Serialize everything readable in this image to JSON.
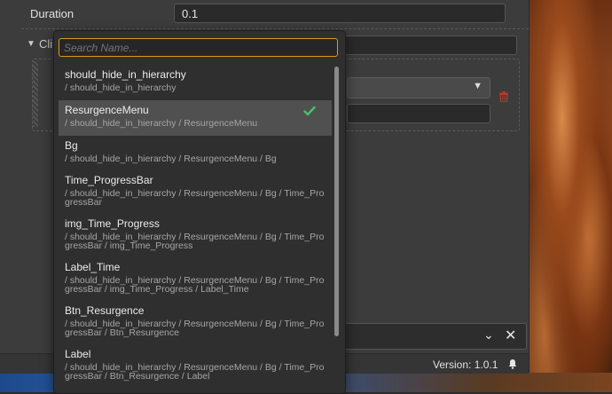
{
  "inspector": {
    "duration_label": "Duration",
    "duration_value": "0.1",
    "clips_label": "Cli",
    "version": "Version: 1.0.1"
  },
  "dropdown": {
    "search_placeholder": "Search Name...",
    "items": [
      {
        "name": "should_hide_in_hierarchy",
        "path": "/ should_hide_in_hierarchy",
        "selected": false
      },
      {
        "name": "ResurgenceMenu",
        "path": "/ should_hide_in_hierarchy / ResurgenceMenu",
        "selected": true
      },
      {
        "name": "Bg",
        "path": "/ should_hide_in_hierarchy / ResurgenceMenu / Bg",
        "selected": false
      },
      {
        "name": "Time_ProgressBar",
        "path": "/ should_hide_in_hierarchy / ResurgenceMenu / Bg / Time_ProgressBar",
        "selected": false
      },
      {
        "name": "img_Time_Progress",
        "path": "/ should_hide_in_hierarchy / ResurgenceMenu / Bg / Time_ProgressBar / img_Time_Progress",
        "selected": false
      },
      {
        "name": "Label_Time",
        "path": "/ should_hide_in_hierarchy / ResurgenceMenu / Bg / Time_ProgressBar / img_Time_Progress / Label_Time",
        "selected": false
      },
      {
        "name": "Btn_Resurgence",
        "path": "/ should_hide_in_hierarchy / ResurgenceMenu / Bg / Time_ProgressBar / Btn_Resurgence",
        "selected": false
      },
      {
        "name": "Label",
        "path": "/ should_hide_in_hierarchy / ResurgenceMenu / Bg / Time_ProgressBar / Btn_Resurgence / Label",
        "selected": false
      }
    ]
  },
  "colors": {
    "accent_focus": "#d99a1e",
    "check_green": "#4cc16a",
    "trash_red": "#c0392b"
  }
}
